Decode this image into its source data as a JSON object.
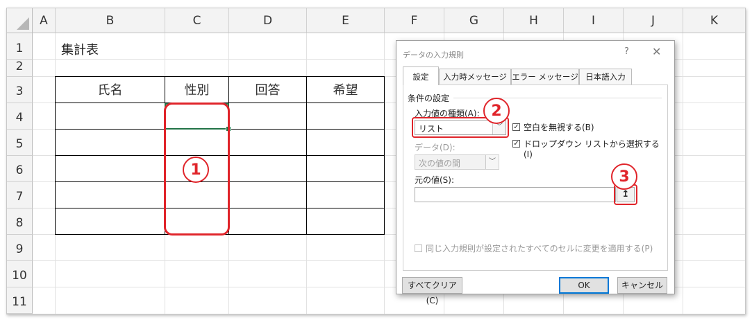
{
  "spreadsheet": {
    "columns": [
      "A",
      "B",
      "C",
      "D",
      "E",
      "F",
      "G",
      "H",
      "I",
      "J",
      "K"
    ],
    "rows": [
      "1",
      "2",
      "3",
      "4",
      "5",
      "6",
      "7",
      "8",
      "9",
      "10",
      "11"
    ],
    "title_cell": "集計表",
    "table_headers": [
      "氏名",
      "性別",
      "回答",
      "希望"
    ]
  },
  "dialog": {
    "title": "データの入力規則",
    "help": "?",
    "close": "✕",
    "tabs": [
      "設定",
      "入力時メッセージ",
      "エラー メッセージ",
      "日本語入力"
    ],
    "active_tab": "設定",
    "group_label": "条件の設定",
    "allow_label": "入力値の種類(A):",
    "allow_value": "リスト",
    "ignore_blank_label": "空白を無視する(B)",
    "ignore_blank_checked": true,
    "dropdown_label": "ドロップダウン リストから選択する(I)",
    "dropdown_checked": true,
    "data_label": "データ(D):",
    "data_value": "次の値の間",
    "source_label": "元の値(S):",
    "source_value": "",
    "ref_icon": "↥",
    "apply_all_label": "同じ入力規則が設定されたすべてのセルに変更を適用する(P)",
    "apply_all_checked": false,
    "clear_all_button": "すべてクリア(C)",
    "ok_button": "OK",
    "cancel_button": "キャンセル"
  },
  "annotations": {
    "badge_1": "1",
    "badge_2": "2",
    "badge_3": "3",
    "highlight_color": "#e0242a"
  }
}
